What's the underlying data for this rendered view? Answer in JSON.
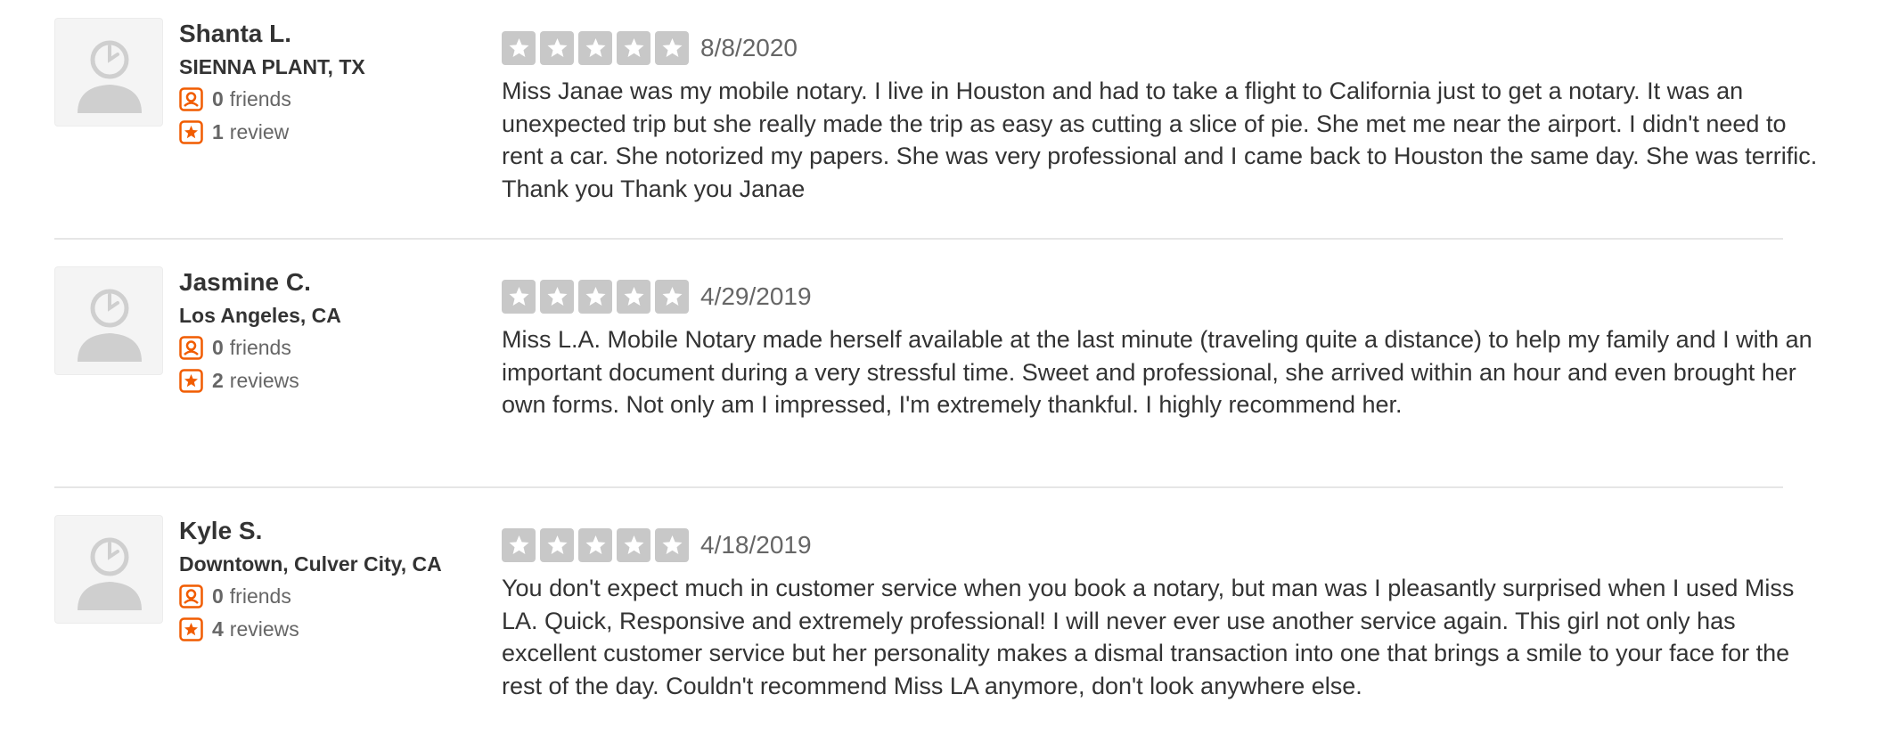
{
  "colors": {
    "accent": "#f15c00",
    "star_empty": "#c8c8c8",
    "divider": "#e6e6e6",
    "text": "#333333",
    "muted": "#666666"
  },
  "icons": {
    "avatar": "default-user-avatar-icon",
    "friends": "friends-icon",
    "reviews": "review-star-icon",
    "star": "star-icon"
  },
  "reviews": [
    {
      "user": {
        "name": "Shanta L.",
        "location": "SIENNA PLANT, TX",
        "friends_count": "0",
        "friends_label": "friends",
        "reviews_count": "1",
        "reviews_label": "review"
      },
      "rating": 0,
      "date": "8/8/2020",
      "text": "Miss Janae was my mobile notary. I live in Houston and had to take a flight to California just to get a notary. It was an unexpected trip but she really made the trip as easy as cutting a slice of pie. She met me near the airport. I didn't need to rent a car. She notorized my papers. She was very professional and I came back to Houston the same day. She was terrific. Thank you Thank you Janae"
    },
    {
      "user": {
        "name": "Jasmine C.",
        "location": "Los Angeles, CA",
        "friends_count": "0",
        "friends_label": "friends",
        "reviews_count": "2",
        "reviews_label": "reviews"
      },
      "rating": 0,
      "date": "4/29/2019",
      "text": "Miss L.A. Mobile Notary made herself available at the last minute (traveling quite a distance) to help my family and I with an important document during a very stressful time.  Sweet and professional, she arrived within an hour and even brought her own forms.  Not only am I impressed, I'm extremely thankful.  I highly recommend her."
    },
    {
      "user": {
        "name": "Kyle S.",
        "location": "Downtown, Culver City, CA",
        "friends_count": "0",
        "friends_label": "friends",
        "reviews_count": "4",
        "reviews_label": "reviews"
      },
      "rating": 0,
      "date": "4/18/2019",
      "text": "You don't expect much in customer service when you book a notary, but man was I pleasantly surprised when I used Miss LA. Quick, Responsive and extremely professional! I will never ever use another service again. This girl not only has excellent customer service but her personality makes a dismal transaction into one that brings a smile to your face for the rest of the day. Couldn't recommend Miss LA anymore, don't look anywhere else."
    }
  ]
}
